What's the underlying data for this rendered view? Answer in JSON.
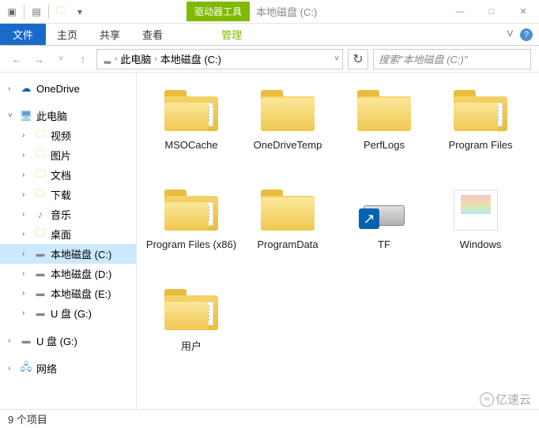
{
  "window": {
    "title": "本地磁盘 (C:)",
    "context_tab": "驱动器工具",
    "controls": {
      "minimize": "—",
      "maximize": "□",
      "close": "✕"
    }
  },
  "ribbon": {
    "file": "文件",
    "tabs": [
      "主页",
      "共享",
      "查看"
    ],
    "manage": "管理",
    "expand": "˅"
  },
  "address": {
    "crumbs": [
      "此电脑",
      "本地磁盘 (C:)"
    ],
    "search_placeholder": "搜索\"本地磁盘 (C:)\""
  },
  "nav": {
    "onedrive": "OneDrive",
    "pc": "此电脑",
    "pc_items": [
      {
        "label": "视频",
        "icon": "video"
      },
      {
        "label": "图片",
        "icon": "pictures"
      },
      {
        "label": "文档",
        "icon": "documents"
      },
      {
        "label": "下载",
        "icon": "downloads"
      },
      {
        "label": "音乐",
        "icon": "music"
      },
      {
        "label": "桌面",
        "icon": "desktop"
      },
      {
        "label": "本地磁盘 (C:)",
        "icon": "drive",
        "selected": true
      },
      {
        "label": "本地磁盘 (D:)",
        "icon": "drive"
      },
      {
        "label": "本地磁盘 (E:)",
        "icon": "drive"
      },
      {
        "label": "U 盘 (G:)",
        "icon": "usb"
      }
    ],
    "usb": "U 盘 (G:)",
    "network": "网络"
  },
  "items": [
    {
      "name": "MSOCache",
      "type": "folder-docs"
    },
    {
      "name": "OneDriveTemp",
      "type": "folder"
    },
    {
      "name": "PerfLogs",
      "type": "folder"
    },
    {
      "name": "Program Files",
      "type": "folder-docs"
    },
    {
      "name": "Program Files (x86)",
      "type": "folder-docs"
    },
    {
      "name": "ProgramData",
      "type": "folder"
    },
    {
      "name": "TF",
      "type": "drive-shortcut"
    },
    {
      "name": "Windows",
      "type": "windows"
    },
    {
      "name": "用户",
      "type": "folder-docs"
    }
  ],
  "status": {
    "count": "9 个项目"
  },
  "watermark": "亿速云"
}
